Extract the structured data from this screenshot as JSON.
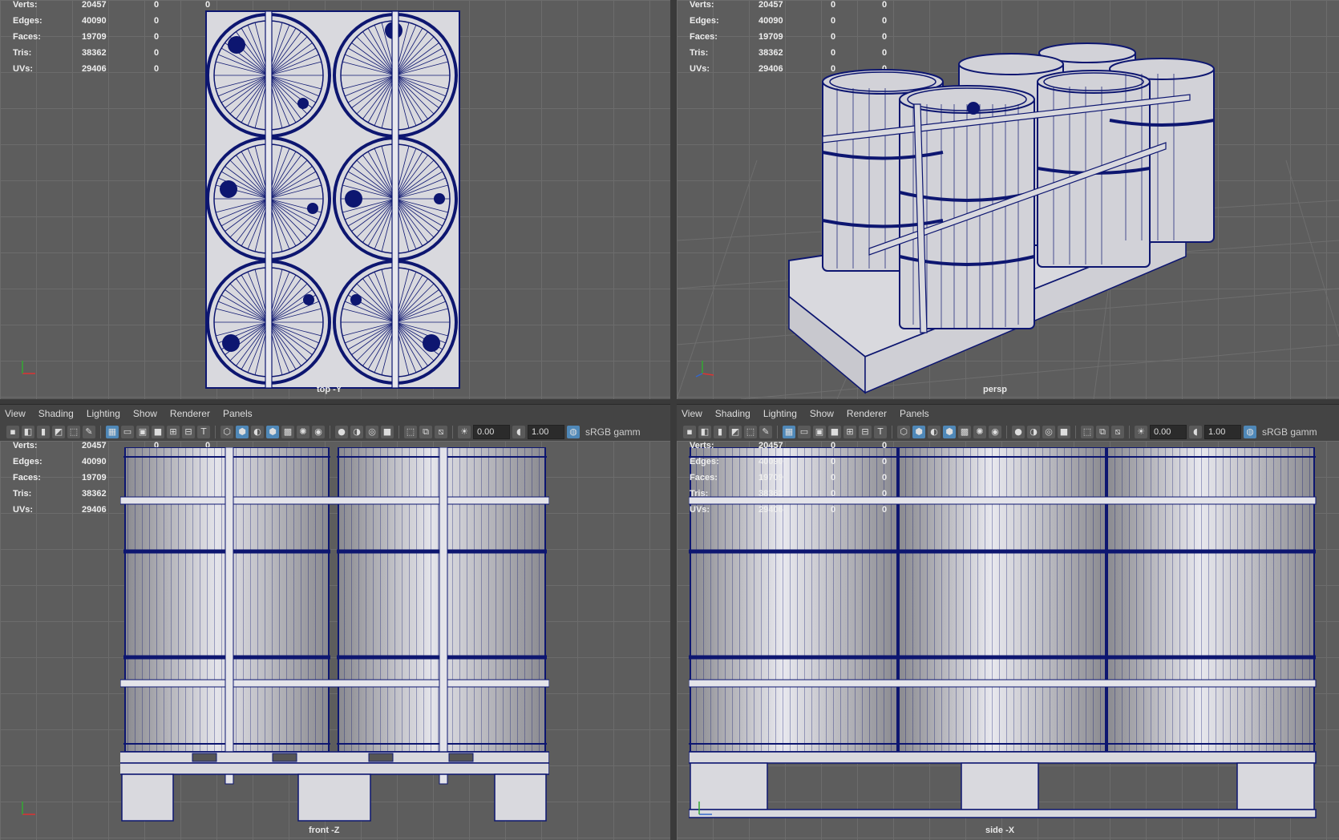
{
  "hud": {
    "rows": [
      {
        "label": "Verts:",
        "total": "20457",
        "sel": "0",
        "comp": "0"
      },
      {
        "label": "Edges:",
        "total": "40090",
        "sel": "0",
        "comp": "0"
      },
      {
        "label": "Faces:",
        "total": "19709",
        "sel": "0",
        "comp": "0"
      },
      {
        "label": "Tris:",
        "total": "38362",
        "sel": "0",
        "comp": "0"
      },
      {
        "label": "UVs:",
        "total": "29406",
        "sel": "0",
        "comp": "0"
      }
    ]
  },
  "viewports": {
    "top": {
      "camera": "top -Y"
    },
    "persp": {
      "camera": "persp"
    },
    "front": {
      "camera": "front -Z"
    },
    "side": {
      "camera": "side -X"
    }
  },
  "panel_menu": [
    "View",
    "Shading",
    "Lighting",
    "Show",
    "Renderer",
    "Panels"
  ],
  "panel_toolbar": {
    "exposure": "0.00",
    "gamma": "1.00",
    "color_space": "sRGB gamm"
  },
  "colors": {
    "viewport_bg": "#5d5d5d",
    "wireframe": "#0d1670",
    "mesh_fill": "#d9d9de",
    "selected_tool": "#4f88b8"
  }
}
